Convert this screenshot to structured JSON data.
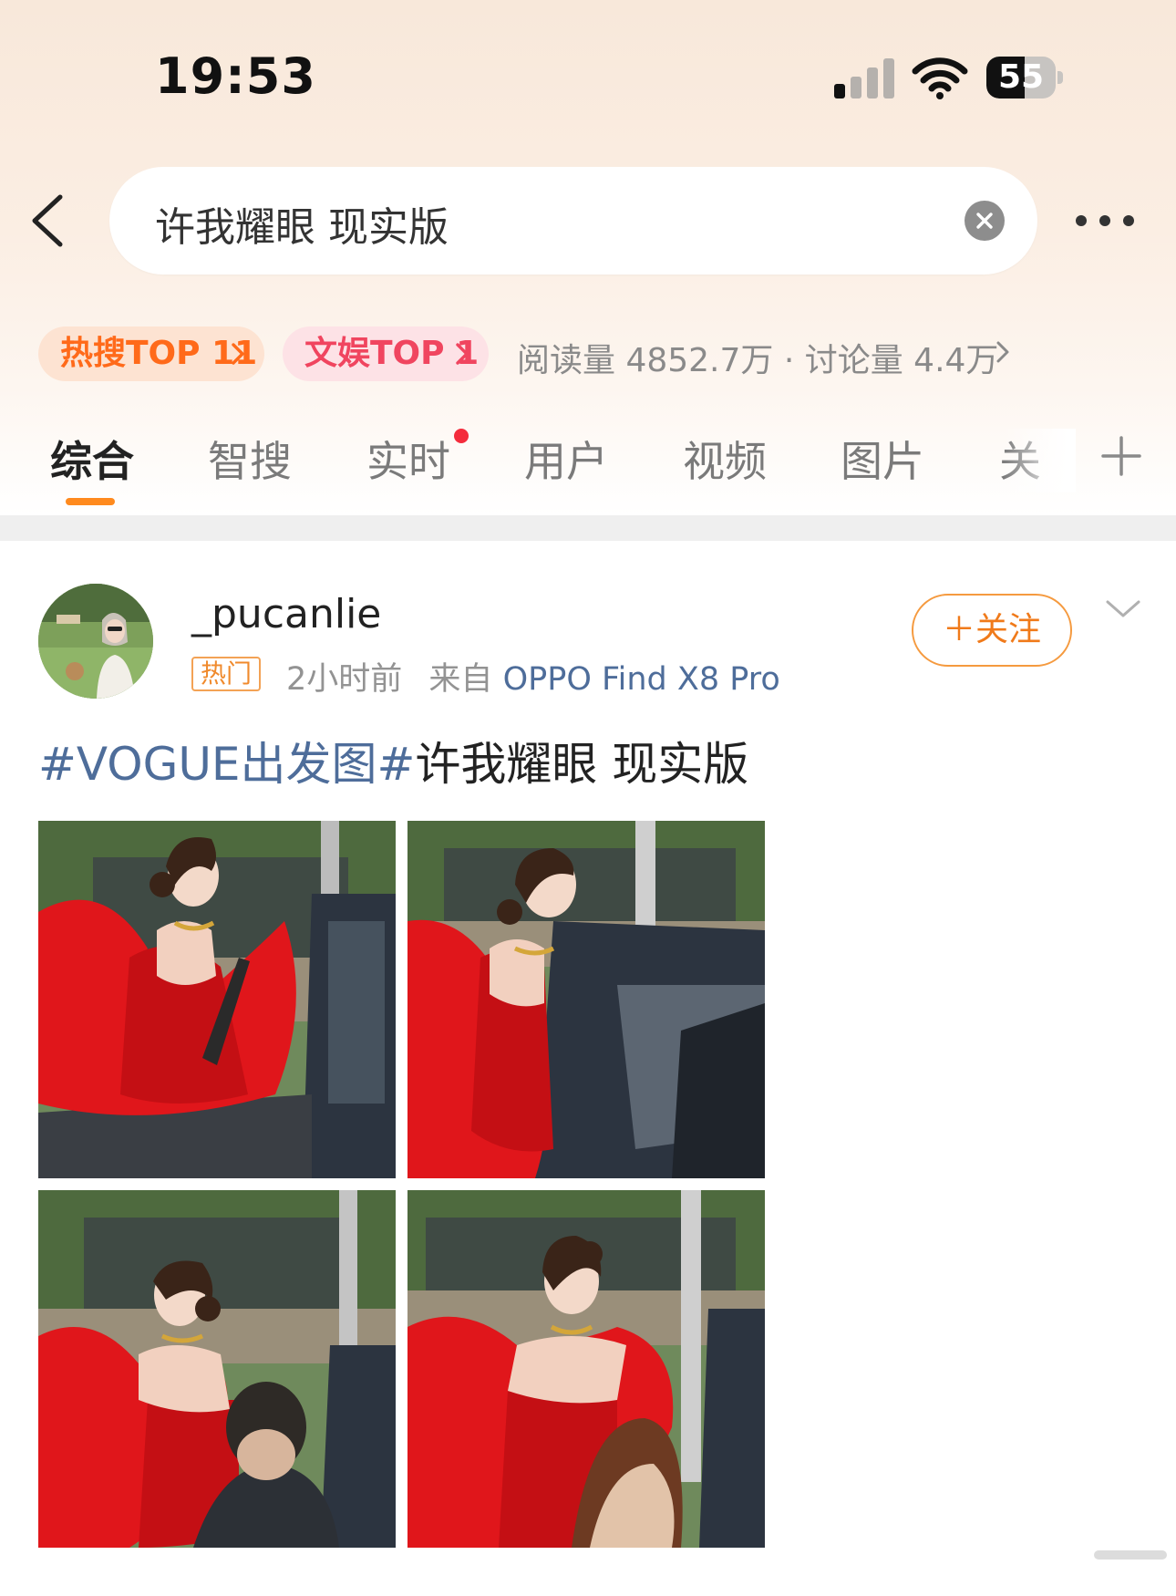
{
  "status_bar": {
    "time": "19:53",
    "battery": "55",
    "battery_level_percent": 55,
    "signal_bars_active": 1,
    "signal_bars_total": 4
  },
  "search": {
    "query": "许我耀眼 现实版"
  },
  "hot_row": {
    "pill1": "热搜TOP 11",
    "pill2": "文娱TOP 1",
    "stats": "阅读量 4852.7万 · 讨论量 4.4万"
  },
  "tabs": [
    "综合",
    "智搜",
    "实时",
    "用户",
    "视频",
    "图片",
    "关"
  ],
  "post": {
    "username": "_pucanlie",
    "hot_tag": "热门",
    "time_ago": "2小时前",
    "source_prefix": "来自",
    "device": "OPPO Find X8 Pro",
    "follow_label": "＋关注",
    "topic": "#VOGUE出发图#",
    "text": "许我耀眼 现实版"
  },
  "colors": {
    "accent_orange": "#ff8a1e",
    "link_blue": "#4e6d9a",
    "hot_red": "#f42c3c",
    "dress_red": "#e0161b"
  },
  "icons": [
    "back-arrow-icon",
    "clear-icon",
    "more-icon",
    "chevron-right-icon",
    "plus-icon",
    "chevron-down-icon",
    "wifi-icon",
    "signal-icon",
    "battery-icon"
  ]
}
